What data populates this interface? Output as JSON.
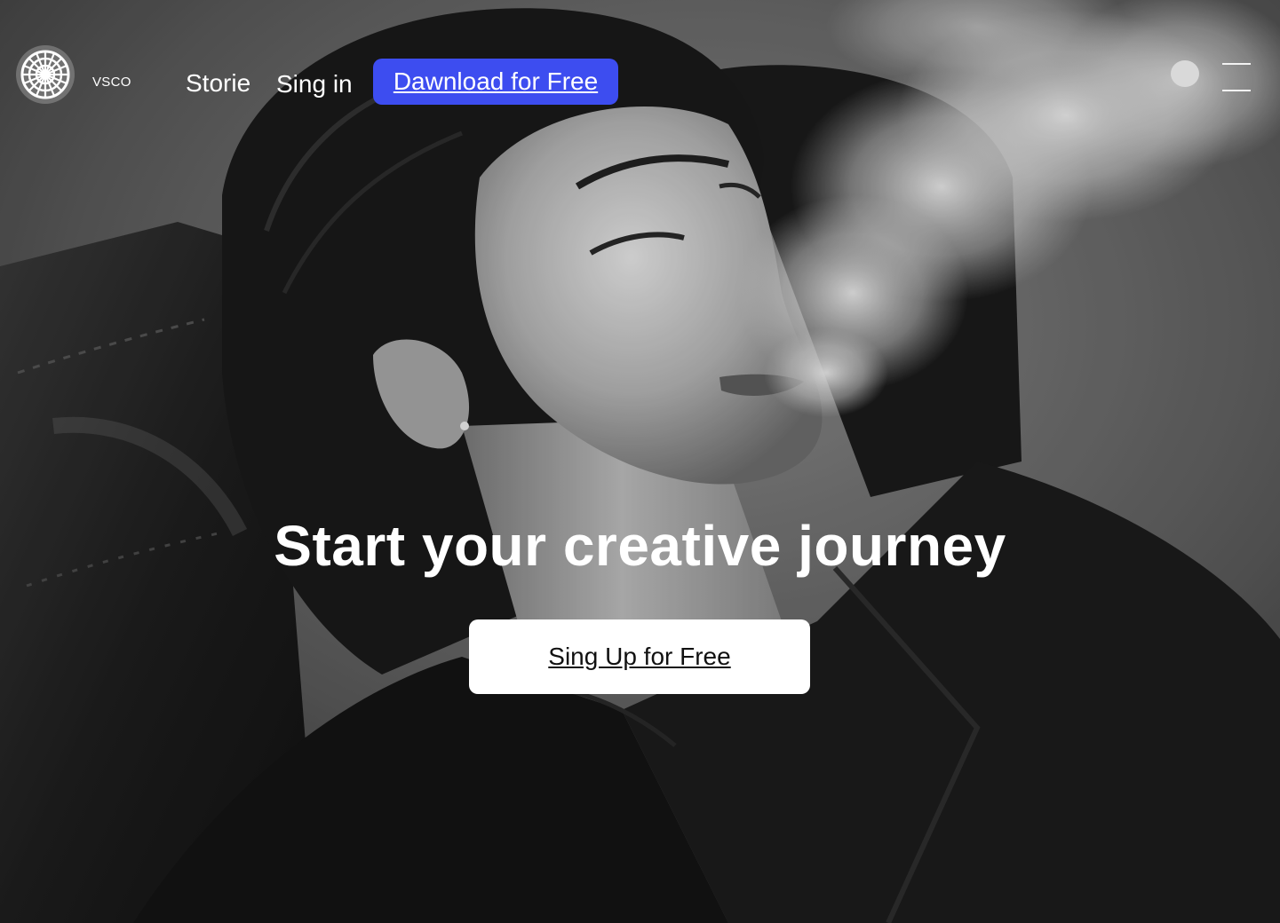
{
  "header": {
    "brand": "VSCO",
    "nav": {
      "stories": "Storie",
      "sign_in": "Sing in",
      "download": "Dawnload for Free"
    }
  },
  "hero": {
    "headline": "Start your creative journey",
    "cta": "Sing Up for Free",
    "photo": "black-and-white portrait of a woman exhaling smoke"
  },
  "icons": {
    "logo": "vsco-logo-icon",
    "avatar": "avatar-dot-icon",
    "menu": "hamburger-menu-icon"
  },
  "colors": {
    "download_button": "#3d4df0",
    "signup_button": "#ffffff",
    "text": "#ffffff"
  }
}
